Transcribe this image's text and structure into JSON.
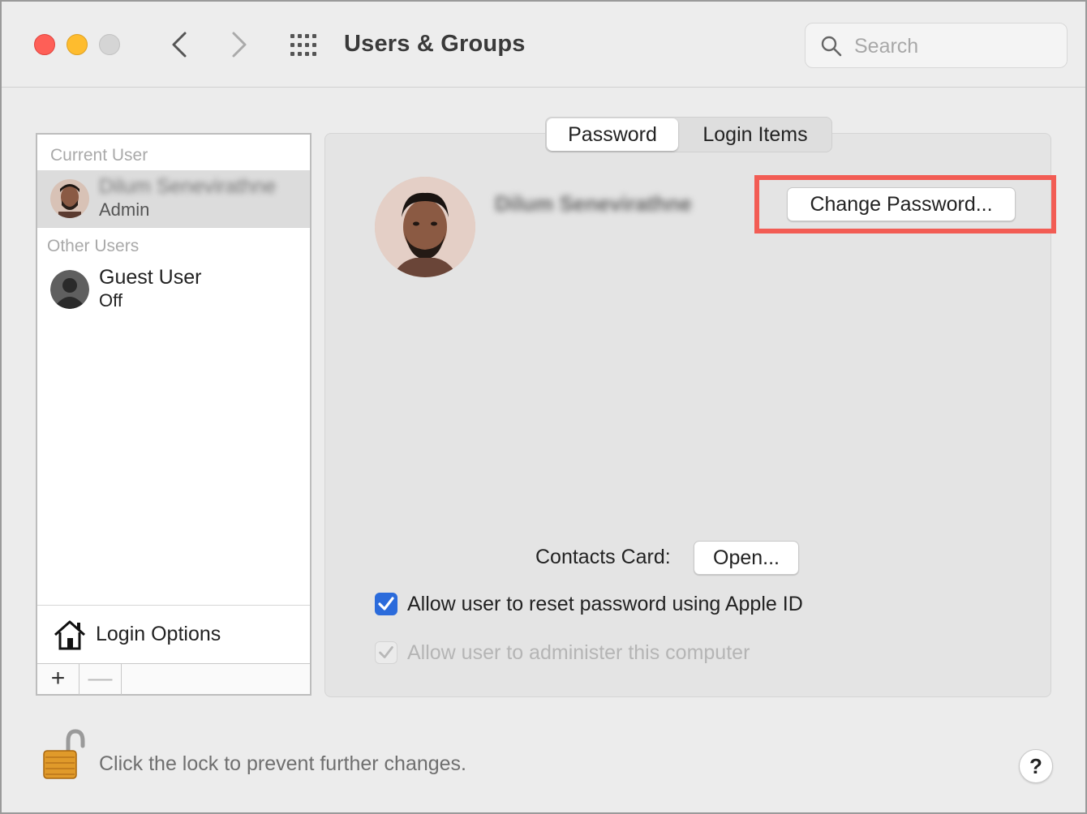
{
  "window": {
    "title": "Users & Groups",
    "search_placeholder": "Search"
  },
  "sidebar": {
    "current_user_label": "Current User",
    "current_user": {
      "name": "Dilum Senevirathne",
      "role": "Admin"
    },
    "other_users_label": "Other Users",
    "other_users": [
      {
        "name": "Guest User",
        "status": "Off"
      }
    ],
    "login_options_label": "Login Options",
    "add_label": "+",
    "remove_label": "—"
  },
  "tabs": [
    {
      "label": "Password",
      "selected": true
    },
    {
      "label": "Login Items",
      "selected": false
    }
  ],
  "main": {
    "user_name": "Dilum Senevirathne",
    "change_password_label": "Change Password...",
    "contacts_card_label": "Contacts Card:",
    "open_label": "Open...",
    "checkboxes": [
      {
        "label": "Allow user to reset password using Apple ID",
        "checked": true,
        "enabled": true
      },
      {
        "label": "Allow user to administer this computer",
        "checked": true,
        "enabled": false
      }
    ]
  },
  "footer": {
    "lock_text": "Click the lock to prevent further changes.",
    "help_label": "?"
  },
  "colors": {
    "accent": "#2b6bdb",
    "highlight": "#f25c54",
    "close": "#fe5f57",
    "minimize": "#febc2e",
    "zoom_disabled": "#d5d5d5"
  }
}
